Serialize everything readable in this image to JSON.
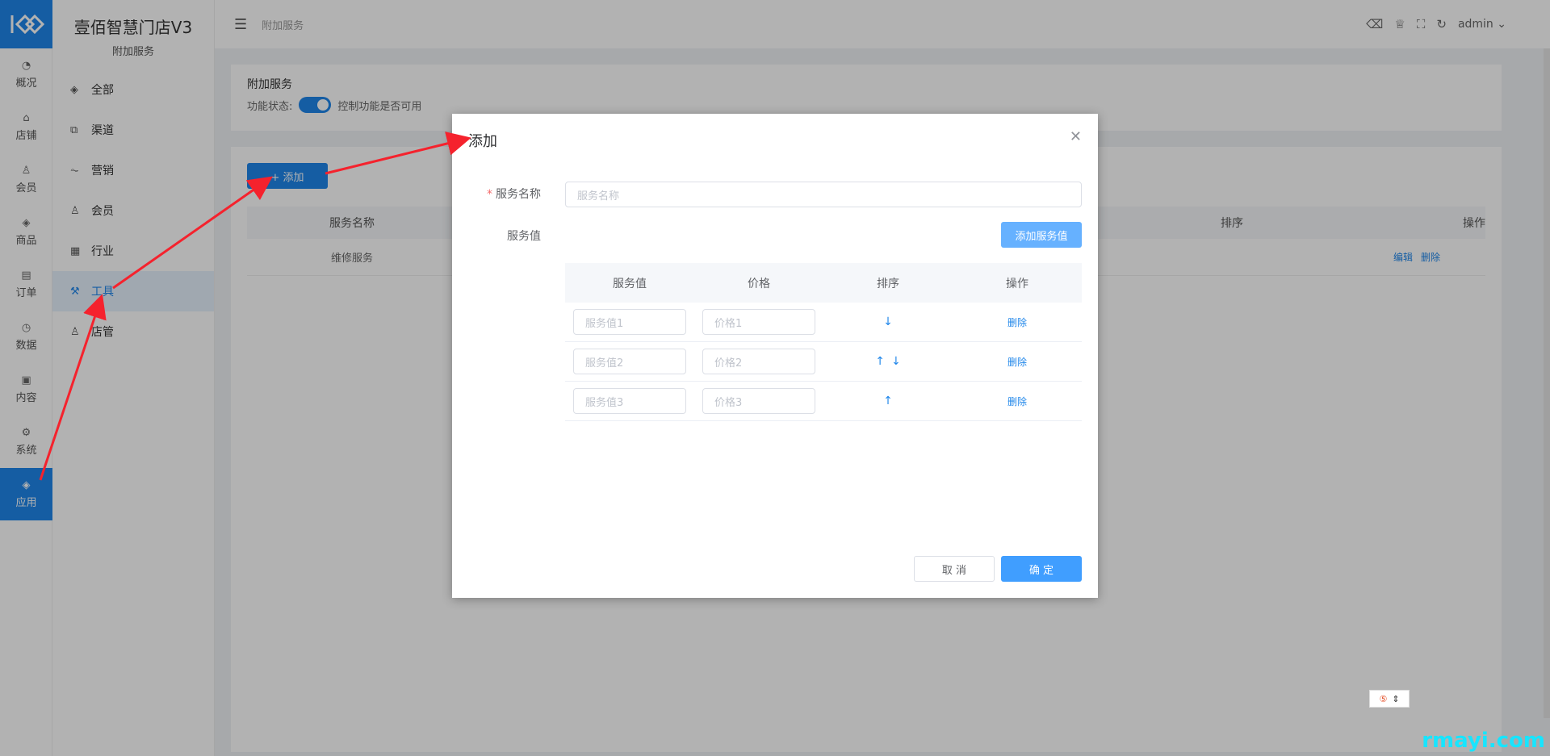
{
  "leftnav": {
    "items": [
      {
        "icon": "dashboard-icon",
        "glyph": "◔",
        "label": "概况"
      },
      {
        "icon": "store-icon",
        "glyph": "⌂",
        "label": "店铺"
      },
      {
        "icon": "member-icon",
        "glyph": "♙",
        "label": "会员"
      },
      {
        "icon": "goods-icon",
        "glyph": "◈",
        "label": "商品"
      },
      {
        "icon": "order-icon",
        "glyph": "▤",
        "label": "订单"
      },
      {
        "icon": "data-icon",
        "glyph": "◷",
        "label": "数据"
      },
      {
        "icon": "content-icon",
        "glyph": "▣",
        "label": "内容"
      },
      {
        "icon": "system-icon",
        "glyph": "⚙",
        "label": "系统"
      },
      {
        "icon": "app-icon",
        "glyph": "◈",
        "label": "应用"
      }
    ]
  },
  "brand": {
    "title": "壹佰智慧门店V3",
    "subtitle": "附加服务"
  },
  "submenu": {
    "items": [
      {
        "icon": "cube-icon",
        "glyph": "◈",
        "label": "全部"
      },
      {
        "icon": "channel-icon",
        "glyph": "⧉",
        "label": "渠道"
      },
      {
        "icon": "marketing-icon",
        "glyph": "⏦",
        "label": "营销"
      },
      {
        "icon": "user-icon",
        "glyph": "♙",
        "label": "会员"
      },
      {
        "icon": "industry-icon",
        "glyph": "▦",
        "label": "行业"
      },
      {
        "icon": "wrench-icon",
        "glyph": "⚒",
        "label": "工具"
      },
      {
        "icon": "staff-icon",
        "glyph": "♙",
        "label": "店管"
      }
    ]
  },
  "topbar": {
    "breadcrumb": "附加服务",
    "user": "admin"
  },
  "page": {
    "section_title": "附加服务",
    "status_label": "功能状态:",
    "status_hint": "控制功能是否可用",
    "add_button": "+ 添加",
    "table_headers": [
      "服务名称",
      "排序",
      "操作"
    ],
    "rows": [
      {
        "name": "维修服务",
        "edit": "编辑",
        "delete": "删除"
      }
    ]
  },
  "dialog": {
    "title": "添加",
    "name_label": "服务名称",
    "name_placeholder": "服务名称",
    "value_label": "服务值",
    "add_value_button": "添加服务值",
    "table_headers": [
      "服务值",
      "价格",
      "排序",
      "操作"
    ],
    "rows": [
      {
        "value_placeholder": "服务值1",
        "price_placeholder": "价格1",
        "up": false,
        "down": true,
        "delete": "删除"
      },
      {
        "value_placeholder": "服务值2",
        "price_placeholder": "价格2",
        "up": true,
        "down": true,
        "delete": "删除"
      },
      {
        "value_placeholder": "服务值3",
        "price_placeholder": "价格3",
        "up": true,
        "down": false,
        "delete": "删除"
      }
    ],
    "cancel_button": "取 消",
    "confirm_button": "确 定"
  },
  "watermark": "rmayi.com",
  "colors": {
    "accent": "#1f86ea",
    "primary_btn": "#409eff",
    "annotation": "#f5222d"
  }
}
